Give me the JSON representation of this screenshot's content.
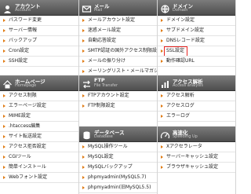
{
  "columns": [
    {
      "sections": [
        {
          "title": "アカウント",
          "subtitle": "Account",
          "icon": "user-icon",
          "items": [
            "パスワード変更",
            "サーバー情報",
            "バックアップ",
            "Cron設定",
            "SSH設定"
          ]
        },
        {
          "title": "ホームページ",
          "subtitle": "Homepage",
          "icon": "homepage-icon",
          "items": [
            "アクセス制限",
            "エラーページ設定",
            "MIME設定",
            ".htaccess編集",
            "サイト転送設定",
            "アクセス拒否設定",
            "CGIツール",
            "簡単インストール",
            "Webフォント設定"
          ]
        }
      ]
    },
    {
      "sections": [
        {
          "title": "メール",
          "subtitle": "Mail",
          "icon": "mail-icon",
          "items": [
            "メールアカウント設定",
            "迷惑メール設定",
            "自動応答設定",
            "SMTP認証の国外アクセス制限設定",
            "メールの振り分け",
            "メーリングリスト・メールマガジン"
          ]
        },
        {
          "title": "FTP",
          "subtitle": "File Transfer",
          "icon": "ftp-icon",
          "items": [
            "FTPアカウント設定",
            "FTP制限設定"
          ]
        },
        {
          "title": "データベース",
          "subtitle": "Database",
          "icon": "database-icon",
          "items": [
            "MySQL操作ツール",
            "MySQL設定",
            "MySQLバックアップ",
            "phpmyadmin(MySQL5.7)",
            "phpmyadmin(旧MySQL5.5)"
          ]
        }
      ]
    },
    {
      "sections": [
        {
          "title": "ドメイン",
          "subtitle": "Domain",
          "icon": "domain-icon",
          "items": [
            "ドメイン設定",
            "サブドメイン設定",
            "DNSレコード設定",
            "SSL設定",
            "動作確認URL"
          ]
        },
        {
          "title": "アクセス解析",
          "subtitle": "Access analysis",
          "icon": "analytics-icon",
          "items": [
            "アクセス解析",
            "アクセスログ",
            "エラーログ"
          ]
        },
        {
          "title": "高速化",
          "subtitle": "Speeding Up",
          "icon": "speedup-icon",
          "items": [
            "Xアクセラレータ",
            "サーバーキャッシュ設定",
            "ブラウザキャッシュ設定"
          ]
        }
      ]
    }
  ],
  "highlighted_item": "SSL設定",
  "colors": {
    "header_bg": "#5f5f5f",
    "arrow": "#e07a12",
    "highlight": "#e8231f"
  }
}
